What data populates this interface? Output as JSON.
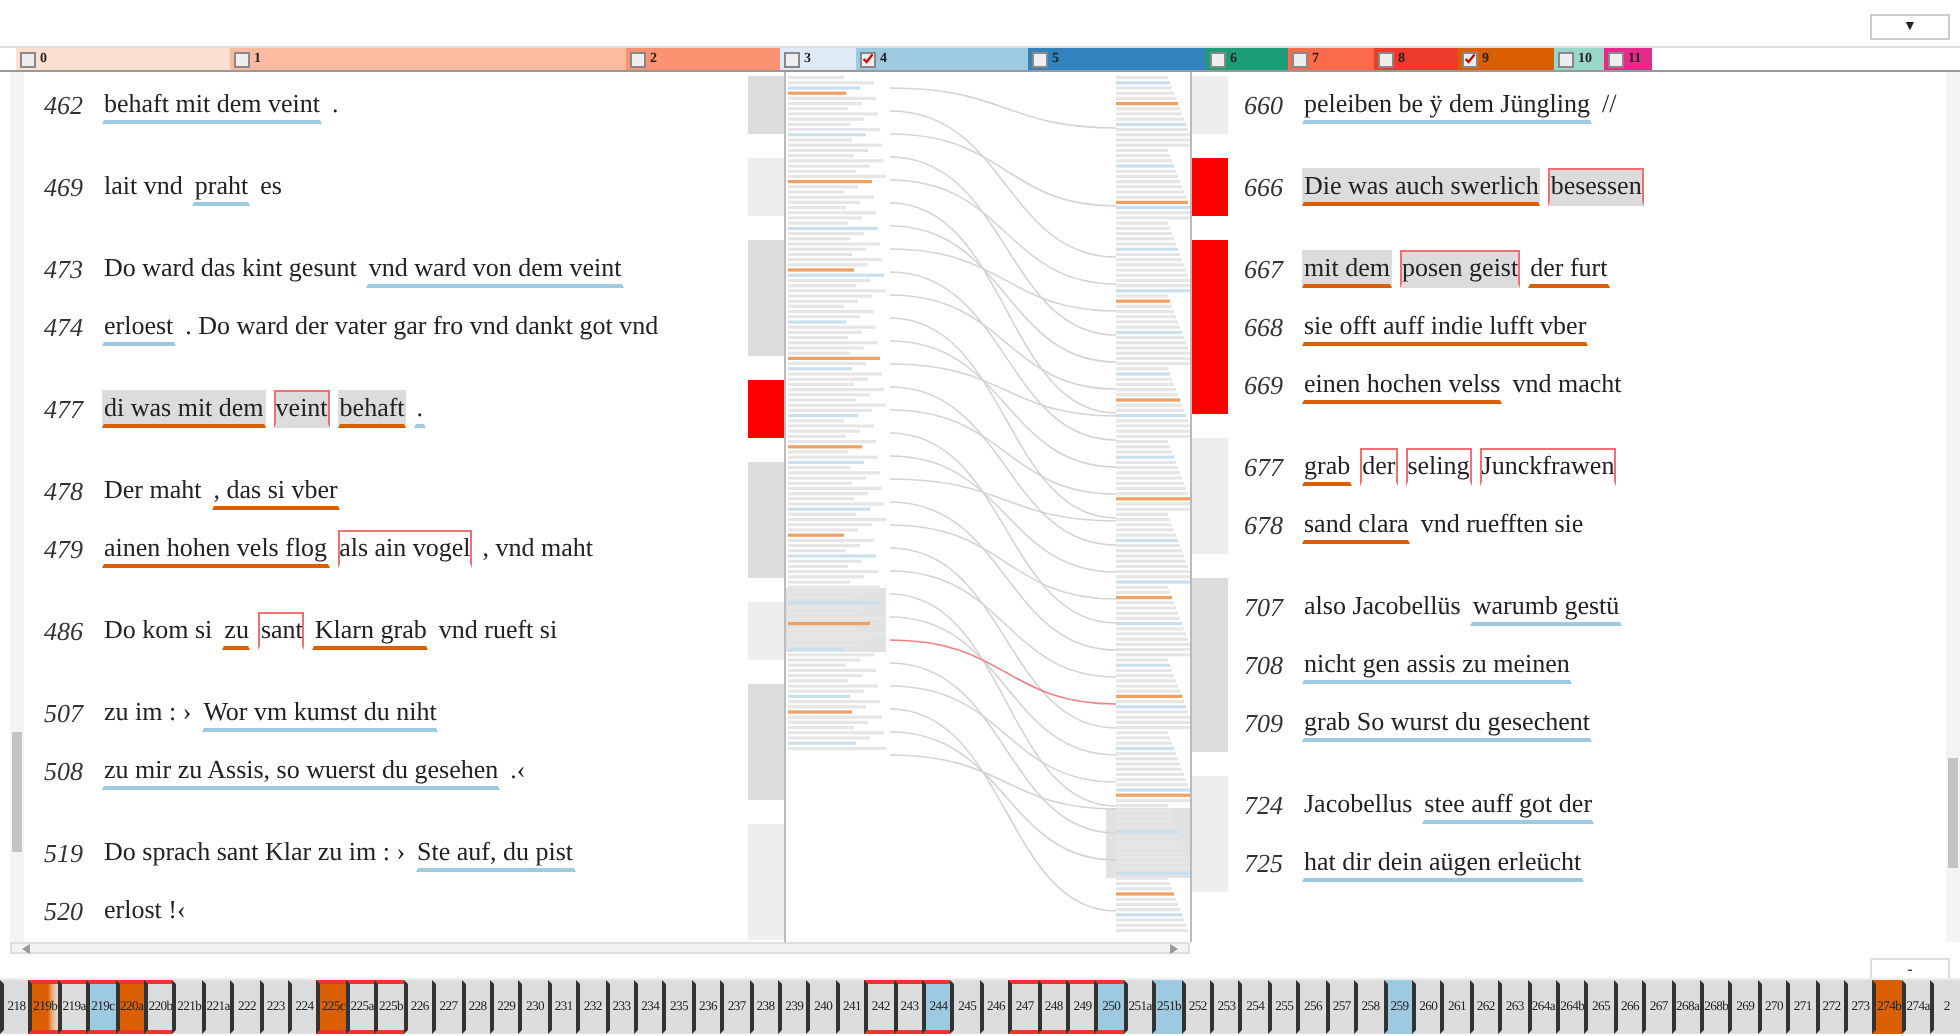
{
  "dropdown": {
    "caret": "▼"
  },
  "legend": [
    {
      "label": "0",
      "color": "#fee0d2",
      "checked": false
    },
    {
      "label": "1",
      "color": "#fcbba1",
      "checked": false
    },
    {
      "label": "2",
      "color": "#fc9272",
      "checked": false
    },
    {
      "label": "3",
      "color": "#deebf7",
      "checked": false
    },
    {
      "label": "4",
      "color": "#9ecae1",
      "checked": true
    },
    {
      "label": "5",
      "color": "#3182bd",
      "checked": false
    },
    {
      "label": "6",
      "color": "#1b9e77",
      "checked": false
    },
    {
      "label": "7",
      "color": "#fb6a4a",
      "checked": false
    },
    {
      "label": "8",
      "color": "#ef3b2c",
      "checked": false
    },
    {
      "label": "9",
      "color": "#d95f02",
      "checked": true
    },
    {
      "label": "10",
      "color": "#99d8c9",
      "checked": false
    },
    {
      "label": "11",
      "color": "#e7298a",
      "checked": false
    }
  ],
  "left_panel": {
    "groups": [
      {
        "color": "#dddddd",
        "lines": [
          {
            "number": "462",
            "segments": [
              {
                "text": "behaft mit dem veint",
                "color": "#9ecae1",
                "boxed": false,
                "shaded": false
              },
              {
                "text": ".",
                "boxed": false,
                "shaded": false
              }
            ]
          }
        ]
      },
      {
        "color": "#eeeeee",
        "lines": [
          {
            "number": "469",
            "segments": [
              {
                "text": "lait vnd",
                "boxed": false,
                "shaded": false
              },
              {
                "text": "praht",
                "color": "#9ecae1",
                "boxed": false,
                "shaded": false
              },
              {
                "text": "es",
                "boxed": false,
                "shaded": false
              }
            ]
          }
        ]
      },
      {
        "color": "#dddddd",
        "lines": [
          {
            "number": "473",
            "segments": [
              {
                "text": "Do ward das kint gesunt",
                "boxed": false,
                "shaded": false
              },
              {
                "text": "vnd ward von dem veint",
                "color": "#9ecae1",
                "boxed": false,
                "shaded": false
              }
            ]
          },
          {
            "number": "474",
            "segments": [
              {
                "text": "erloest",
                "color": "#9ecae1",
                "boxed": false,
                "shaded": false
              },
              {
                "text": ". Do ward der vater gar fro vnd dankt got vnd",
                "boxed": false,
                "shaded": false
              }
            ]
          }
        ]
      },
      {
        "color": "#ff0000",
        "lines": [
          {
            "number": "477",
            "segments": [
              {
                "text": "di was mit dem",
                "color": "#d95f02",
                "boxed": false,
                "shaded": true
              },
              {
                "text": "veint",
                "boxed": true,
                "shaded": true
              },
              {
                "text": "behaft",
                "color": "#d95f02",
                "boxed": false,
                "shaded": true
              },
              {
                "text": ".",
                "color": "#9ecae1",
                "boxed": false,
                "shaded": false
              }
            ]
          }
        ]
      },
      {
        "color": "#dddddd",
        "lines": [
          {
            "number": "478",
            "segments": [
              {
                "text": "Der maht",
                "boxed": false,
                "shaded": false
              },
              {
                "text": ", das si vber",
                "color": "#d95f02",
                "boxed": false,
                "shaded": false
              }
            ]
          },
          {
            "number": "479",
            "segments": [
              {
                "text": "ainen hohen vels flog",
                "color": "#d95f02",
                "boxed": false,
                "shaded": false
              },
              {
                "text": "als ain vogel",
                "boxed": true,
                "shaded": false
              },
              {
                "text": ", vnd maht",
                "boxed": false,
                "shaded": false
              }
            ]
          }
        ]
      },
      {
        "color": "#eeeeee",
        "lines": [
          {
            "number": "486",
            "segments": [
              {
                "text": "Do kom si",
                "boxed": false,
                "shaded": false
              },
              {
                "text": "zu",
                "color": "#d95f02",
                "boxed": false,
                "shaded": false
              },
              {
                "text": "sant",
                "boxed": true,
                "shaded": false
              },
              {
                "text": "Klarn grab",
                "color": "#d95f02",
                "boxed": false,
                "shaded": false
              },
              {
                "text": "vnd rueft si",
                "boxed": false,
                "shaded": false
              }
            ]
          }
        ]
      },
      {
        "color": "#dddddd",
        "lines": [
          {
            "number": "507",
            "segments": [
              {
                "text": "zu im : ›",
                "boxed": false,
                "shaded": false
              },
              {
                "text": "Wor vm kumst du niht",
                "color": "#9ecae1",
                "boxed": false,
                "shaded": false
              }
            ]
          },
          {
            "number": "508",
            "segments": [
              {
                "text": "zu mir zu Assis, so wuerst du gesehen",
                "color": "#9ecae1",
                "boxed": false,
                "shaded": false
              },
              {
                "text": ".‹",
                "boxed": false,
                "shaded": false
              }
            ]
          }
        ]
      },
      {
        "color": "#eeeeee",
        "lines": [
          {
            "number": "519",
            "segments": [
              {
                "text": "Do sprach sant Klar zu im : ›",
                "boxed": false,
                "shaded": false
              },
              {
                "text": "Ste auf, du pist",
                "color": "#9ecae1",
                "boxed": false,
                "shaded": false
              }
            ]
          },
          {
            "number": "520",
            "segments": [
              {
                "text": "erlost !‹",
                "boxed": false,
                "shaded": false
              }
            ]
          }
        ]
      }
    ]
  },
  "right_panel": {
    "groups": [
      {
        "color": "#eeeeee",
        "lines": [
          {
            "number": "660",
            "segments": [
              {
                "text": "peleiben be ÿ dem Jüngling",
                "color": "#9ecae1",
                "boxed": false,
                "shaded": false
              },
              {
                "text": "//",
                "boxed": false,
                "shaded": false
              }
            ]
          }
        ]
      },
      {
        "color": "#ff0000",
        "lines": [
          {
            "number": "666",
            "segments": [
              {
                "text": "Die was auch swerlich",
                "color": "#d95f02",
                "boxed": false,
                "shaded": true
              },
              {
                "text": "besessen",
                "boxed": true,
                "shaded": true
              }
            ]
          }
        ]
      },
      {
        "color": "#ff0000",
        "lines": [
          {
            "number": "667",
            "segments": [
              {
                "text": "mit dem",
                "color": "#d95f02",
                "boxed": false,
                "shaded": true
              },
              {
                "text": "posen geist",
                "boxed": true,
                "shaded": true
              },
              {
                "text": "der furt",
                "color": "#d95f02",
                "boxed": false,
                "shaded": false
              }
            ]
          },
          {
            "number": "668",
            "segments": [
              {
                "text": "sie offt auff indie lufft vber",
                "color": "#d95f02",
                "boxed": false,
                "shaded": false
              }
            ]
          },
          {
            "number": "669",
            "segments": [
              {
                "text": "einen hochen velss",
                "color": "#d95f02",
                "boxed": false,
                "shaded": false
              },
              {
                "text": "vnd macht",
                "boxed": false,
                "shaded": false
              }
            ]
          }
        ]
      },
      {
        "color": "#eeeeee",
        "lines": [
          {
            "number": "677",
            "segments": [
              {
                "text": "grab",
                "color": "#d95f02",
                "boxed": false,
                "shaded": false
              },
              {
                "text": "der",
                "boxed": true,
                "shaded": false
              },
              {
                "text": "seling",
                "boxed": true,
                "shaded": false
              },
              {
                "text": "Junckfrawen",
                "boxed": true,
                "shaded": false
              }
            ]
          },
          {
            "number": "678",
            "segments": [
              {
                "text": "sand clara",
                "color": "#d95f02",
                "boxed": false,
                "shaded": false
              },
              {
                "text": "vnd ruefften sie",
                "boxed": false,
                "shaded": false
              }
            ]
          }
        ]
      },
      {
        "color": "#dddddd",
        "lines": [
          {
            "number": "707",
            "segments": [
              {
                "text": "also Jacobellüs",
                "boxed": false,
                "shaded": false
              },
              {
                "text": "warumb gestü",
                "color": "#9ecae1",
                "boxed": false,
                "shaded": false
              }
            ]
          },
          {
            "number": "708",
            "segments": [
              {
                "text": "nicht gen assis zu meinen",
                "color": "#9ecae1",
                "boxed": false,
                "shaded": false
              }
            ]
          },
          {
            "number": "709",
            "segments": [
              {
                "text": "grab So wurst du gesechent",
                "color": "#9ecae1",
                "boxed": false,
                "shaded": false
              }
            ]
          }
        ]
      },
      {
        "color": "#eeeeee",
        "lines": [
          {
            "number": "724",
            "segments": [
              {
                "text": "Jacobellus",
                "boxed": false,
                "shaded": false
              },
              {
                "text": "stee auff got der",
                "color": "#9ecae1",
                "boxed": false,
                "shaded": false
              }
            ]
          },
          {
            "number": "725",
            "segments": [
              {
                "text": "hat dir dein aügen erleücht",
                "color": "#9ecae1",
                "boxed": false,
                "shaded": false
              }
            ]
          }
        ]
      }
    ]
  },
  "page_field": {
    "value": "-"
  },
  "pages": [
    {
      "label": "218",
      "marked": false
    },
    {
      "label": "219b",
      "color": "#d95f02",
      "kind": "partial",
      "marked": true
    },
    {
      "label": "219a",
      "marked": true
    },
    {
      "label": "219c",
      "color": "#9ecae1",
      "marked": true
    },
    {
      "label": "220a",
      "color": "#d95f02",
      "marked": true
    },
    {
      "label": "220b",
      "marked": true
    },
    {
      "label": "221b",
      "marked": false
    },
    {
      "label": "221a",
      "marked": false
    },
    {
      "label": "222",
      "marked": false
    },
    {
      "label": "223",
      "marked": false
    },
    {
      "label": "224",
      "marked": false
    },
    {
      "label": "225c",
      "color": "#d95f02",
      "marked": true
    },
    {
      "label": "225a",
      "marked": true
    },
    {
      "label": "225b",
      "marked": true
    },
    {
      "label": "226",
      "marked": false
    },
    {
      "label": "227",
      "marked": false
    },
    {
      "label": "228",
      "marked": false
    },
    {
      "label": "229",
      "marked": false
    },
    {
      "label": "230",
      "marked": false
    },
    {
      "label": "231",
      "marked": false
    },
    {
      "label": "232",
      "marked": false
    },
    {
      "label": "233",
      "marked": false
    },
    {
      "label": "234",
      "marked": false
    },
    {
      "label": "235",
      "marked": false
    },
    {
      "label": "236",
      "marked": false
    },
    {
      "label": "237",
      "marked": false
    },
    {
      "label": "238",
      "marked": false
    },
    {
      "label": "239",
      "marked": false
    },
    {
      "label": "240",
      "marked": false
    },
    {
      "label": "241",
      "marked": false
    },
    {
      "label": "242",
      "marked": true
    },
    {
      "label": "243",
      "marked": true
    },
    {
      "label": "244",
      "color": "#9ecae1",
      "marked": true
    },
    {
      "label": "245",
      "marked": false
    },
    {
      "label": "246",
      "marked": false
    },
    {
      "label": "247",
      "marked": true
    },
    {
      "label": "248",
      "marked": true
    },
    {
      "label": "249",
      "marked": true
    },
    {
      "label": "250",
      "color": "#9ecae1",
      "marked": true
    },
    {
      "label": "251a",
      "marked": false
    },
    {
      "label": "251b",
      "color": "#9ecae1",
      "marked": false
    },
    {
      "label": "252",
      "marked": false
    },
    {
      "label": "253",
      "marked": false
    },
    {
      "label": "254",
      "marked": false
    },
    {
      "label": "255",
      "marked": false
    },
    {
      "label": "256",
      "marked": false
    },
    {
      "label": "257",
      "marked": false
    },
    {
      "label": "258",
      "marked": false
    },
    {
      "label": "259",
      "color": "#9ecae1",
      "marked": false
    },
    {
      "label": "260",
      "marked": false
    },
    {
      "label": "261",
      "marked": false
    },
    {
      "label": "262",
      "marked": false
    },
    {
      "label": "263",
      "marked": false
    },
    {
      "label": "264a",
      "marked": false
    },
    {
      "label": "264b",
      "marked": false
    },
    {
      "label": "265",
      "marked": false
    },
    {
      "label": "266",
      "marked": false
    },
    {
      "label": "267",
      "marked": false
    },
    {
      "label": "268a",
      "marked": false
    },
    {
      "label": "268b",
      "marked": false
    },
    {
      "label": "269",
      "marked": false
    },
    {
      "label": "270",
      "marked": false
    },
    {
      "label": "271",
      "marked": false
    },
    {
      "label": "272",
      "marked": false
    },
    {
      "label": "273",
      "marked": false
    },
    {
      "label": "274b",
      "color": "#d95f02",
      "marked": false
    },
    {
      "label": "274a",
      "marked": false
    },
    {
      "label": "2",
      "marked": false
    }
  ]
}
